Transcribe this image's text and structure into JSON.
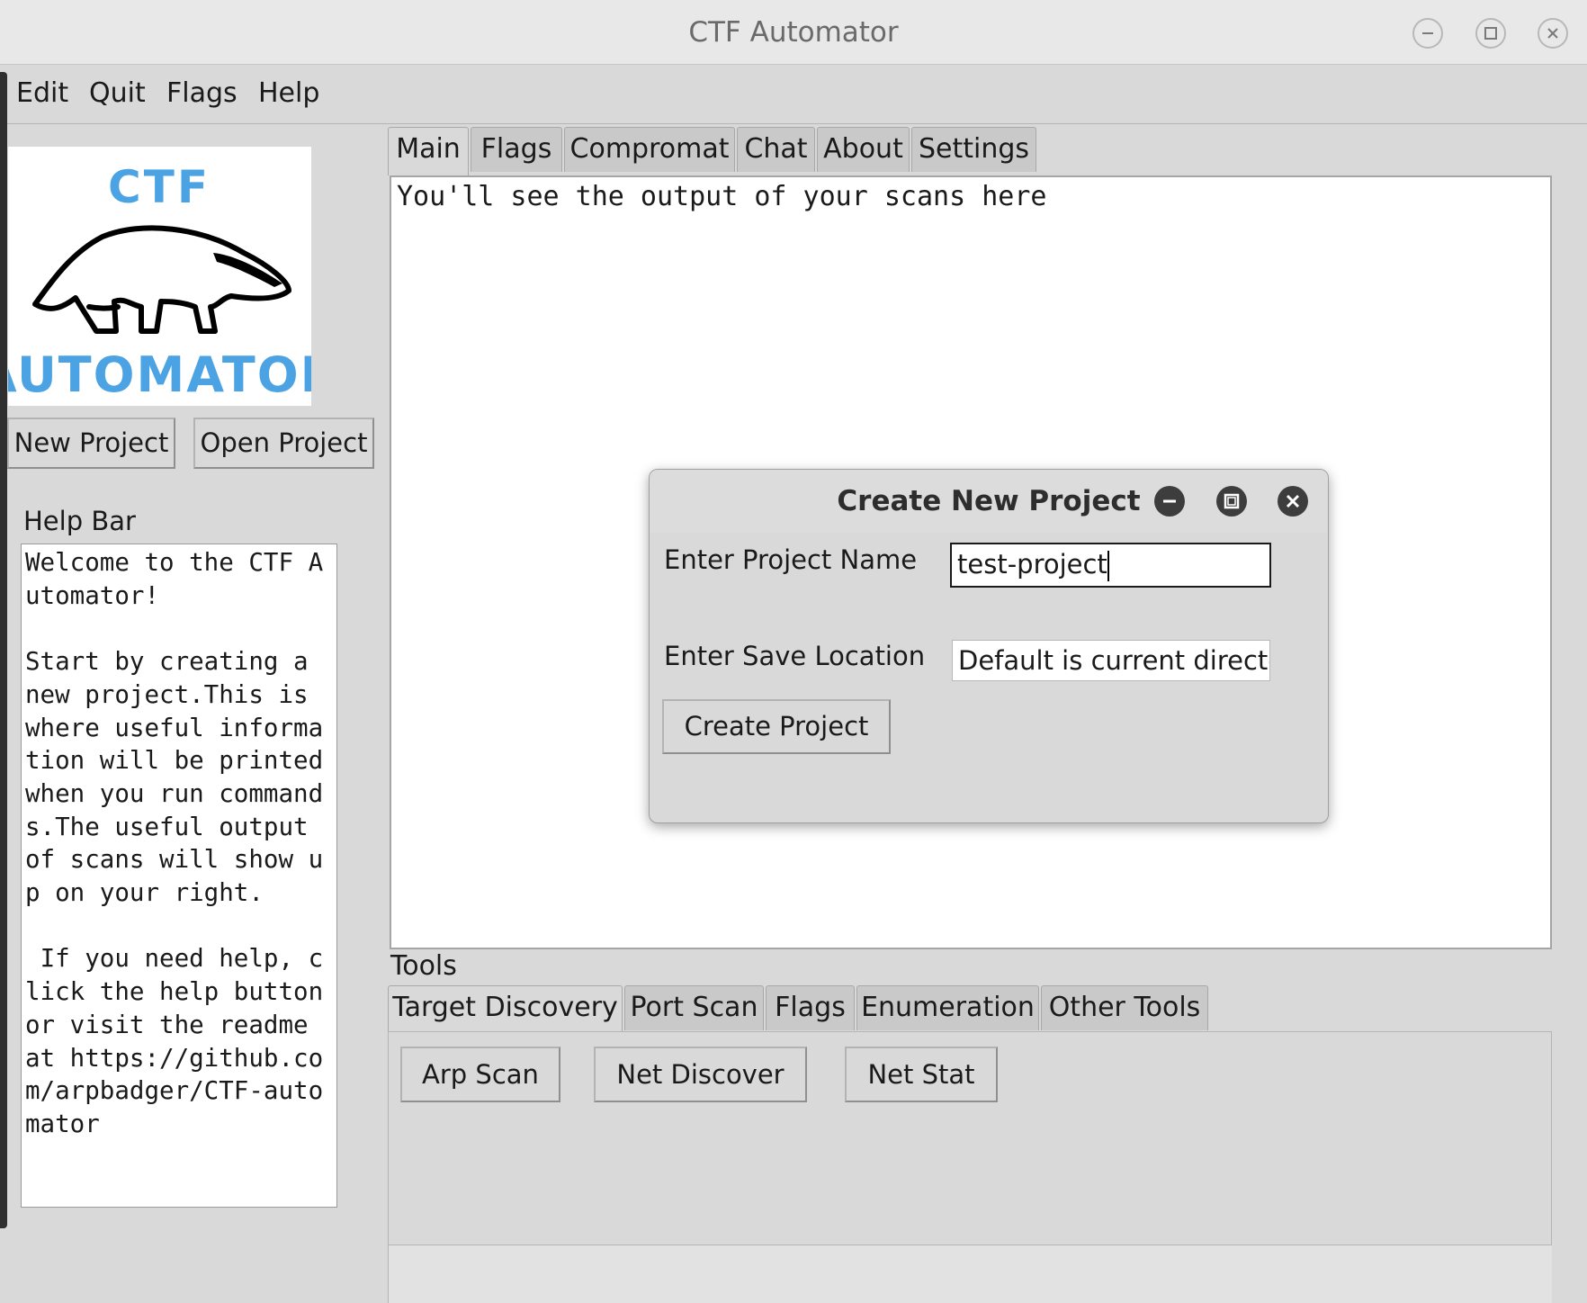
{
  "window": {
    "title": "CTF Automator"
  },
  "menubar": [
    "Edit",
    "Quit",
    "Flags",
    "Help"
  ],
  "logo": {
    "top_text": "CTF",
    "bottom_text": "AUTOMATOR"
  },
  "project_buttons": {
    "new": "New Project",
    "open": "Open Project"
  },
  "helpbar": {
    "label": "Help Bar",
    "text": "Welcome to the CTF Automator!\n\nStart by creating a new project.This is where useful information will be printed when you run commands.The useful output of scans will show up on your right.\n\n If you need help, click the help button or visit the readme at https://github.com/arpbadger/CTF-automator"
  },
  "main_tabs": [
    "Main",
    "Flags",
    "Compromat",
    "Chat",
    "About",
    "Settings"
  ],
  "output": {
    "text": "You'll see the output of your scans here"
  },
  "tools": {
    "label": "Tools",
    "tabs": [
      "Target Discovery",
      "Port Scan",
      "Flags",
      "Enumeration",
      "Other Tools"
    ],
    "buttons": [
      "Arp Scan",
      "Net Discover",
      "Net Stat"
    ]
  },
  "dialog": {
    "title": "Create New Project",
    "name_label": "Enter Project Name",
    "name_value": "test-project",
    "location_label": "Enter Save Location",
    "location_value": "Default is current directo",
    "create_button": "Create Project"
  },
  "colors": {
    "logo_text": "#4ba3e3",
    "background": "#d9d9d9"
  }
}
